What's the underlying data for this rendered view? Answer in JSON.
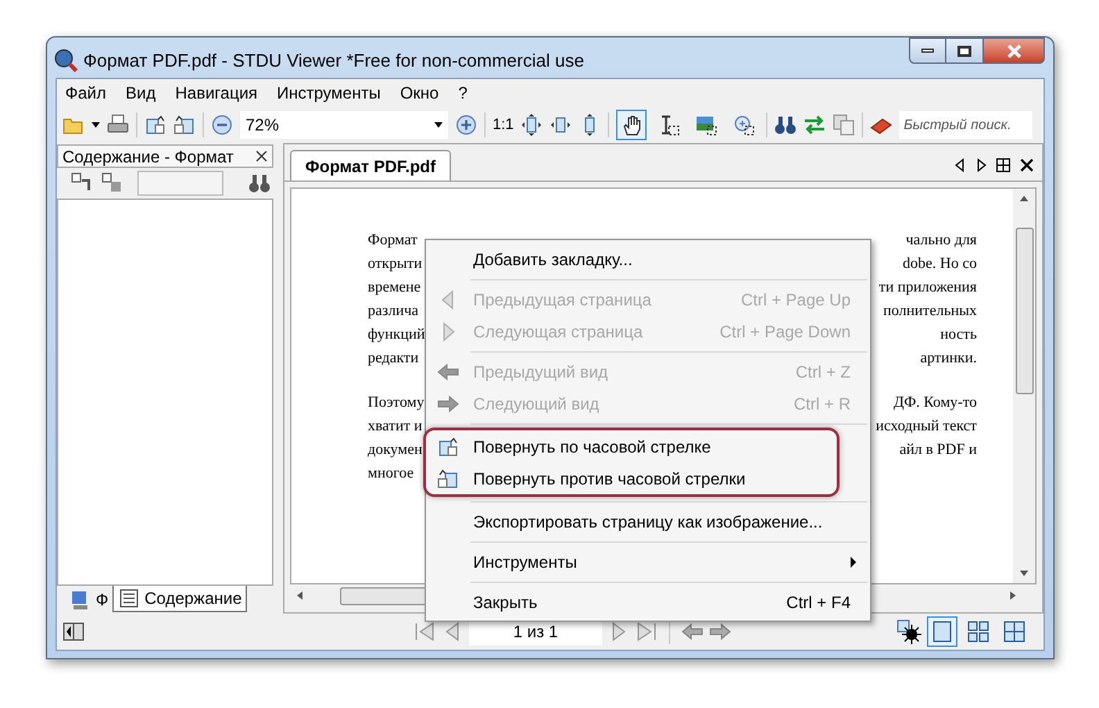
{
  "window": {
    "title": "Формат PDF.pdf - STDU Viewer *Free for non-commercial use"
  },
  "menu_bar": [
    "Файл",
    "Вид",
    "Навигация",
    "Инструменты",
    "Окно",
    "?"
  ],
  "toolbar": {
    "zoom": "72%",
    "actual_size": "1:1",
    "select_tools": [
      {
        "selected": true
      },
      {
        "selected": false
      },
      {
        "selected": false
      },
      {
        "selected": false
      }
    ],
    "search": {
      "placeholder": "Быстрый поиск."
    }
  },
  "left_panel": {
    "title": "Содержание - Формат",
    "tabs": [
      {
        "label": "Ф",
        "selected": false
      },
      {
        "label": "Содержание",
        "selected": true
      }
    ]
  },
  "document_tabs": [
    {
      "label": "Формат PDF.pdf",
      "selected": true
    }
  ],
  "document": {
    "paragraphs": [
      {
        "lines": [
          {
            "left": "Формат",
            "right": "чально для"
          },
          {
            "left": "открыти",
            "right": "dobe. Но со"
          },
          {
            "left": "времене",
            "right": "ти приложения"
          },
          {
            "left": "различа",
            "right": "полнительных"
          },
          {
            "left": "функций",
            "right": "ность"
          },
          {
            "left": "редакти",
            "right": "артинки."
          }
        ]
      },
      {
        "lines": [
          {
            "left": "Поэтому",
            "right": "ДФ. Кому-то"
          },
          {
            "left": "хватит и",
            "right": "исходный текст"
          },
          {
            "left": "докумен",
            "right": "айл в PDF и"
          },
          {
            "left": "многое"
          }
        ]
      }
    ]
  },
  "context_menu": {
    "items": [
      {
        "kind": "item",
        "label": "Добавить закладку...",
        "disabled": false
      },
      {
        "kind": "separator"
      },
      {
        "kind": "item",
        "label": "Предыдущая страница",
        "shortcut": "Ctrl + Page Up",
        "disabled": true
      },
      {
        "kind": "item",
        "label": "Следующая страница",
        "shortcut": "Ctrl + Page Down",
        "disabled": true
      },
      {
        "kind": "separator"
      },
      {
        "kind": "item",
        "label": "Предыдущий вид",
        "shortcut": "Ctrl + Z",
        "disabled": true
      },
      {
        "kind": "item",
        "label": "Следующий вид",
        "shortcut": "Ctrl + R",
        "disabled": true
      },
      {
        "kind": "separator"
      },
      {
        "kind": "group",
        "highlighted": true,
        "items": [
          {
            "kind": "item",
            "label": "Повернуть по часовой стрелке",
            "disabled": false
          },
          {
            "kind": "item",
            "label": "Повернуть против часовой стрелки",
            "disabled": false
          }
        ]
      },
      {
        "kind": "separator"
      },
      {
        "kind": "item",
        "label": "Экспортировать страницу как изображение...",
        "disabled": false
      },
      {
        "kind": "separator"
      },
      {
        "kind": "item",
        "label": "Инструменты",
        "submenu": true,
        "disabled": false
      },
      {
        "kind": "separator"
      },
      {
        "kind": "item",
        "label": "Закрыть",
        "shortcut": "Ctrl + F4",
        "disabled": false
      }
    ]
  },
  "status_bar": {
    "page": "1 из 1",
    "view_modes": [
      {
        "selected": true
      },
      {
        "selected": false
      },
      {
        "selected": false
      }
    ]
  }
}
